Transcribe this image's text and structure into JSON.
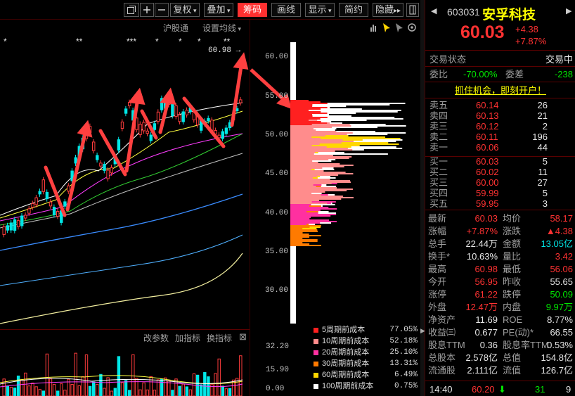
{
  "toolbar": {
    "buttons": [
      "复权",
      "叠加",
      "筹码",
      "画线",
      "显示",
      "简约",
      "隐藏"
    ],
    "active": "筹码",
    "icons": [
      "restore-icon",
      "plus-icon",
      "minus-icon",
      "collapse-icon"
    ]
  },
  "chart_header": {
    "hugutong": "沪股通",
    "ma_setting": "设置均线"
  },
  "kline": {
    "peak_label": "60.98",
    "star_markers": [
      "*",
      "**",
      "***",
      "*",
      "*",
      "*",
      "**"
    ],
    "price_ticks": [
      "60.00",
      "55.00",
      "50.00",
      "45.00",
      "40.00",
      "35.00",
      "30.00"
    ]
  },
  "volume": {
    "buttons": [
      "改参数",
      "加指标",
      "换指标"
    ],
    "close_glyph": "⊠",
    "ticks": [
      "32.20",
      "15.90",
      "0.00"
    ]
  },
  "chip_legend": [
    {
      "label": "5周期前成本",
      "value": "77.05%",
      "color": "#ff2020"
    },
    {
      "label": "10周期前成本",
      "value": "52.18%",
      "color": "#ff8c8c"
    },
    {
      "label": "20周期前成本",
      "value": "25.10%",
      "color": "#ff30a0"
    },
    {
      "label": "30周期前成本",
      "value": "13.31%",
      "color": "#ff7a00"
    },
    {
      "label": "60周期前成本",
      "value": "6.49%",
      "color": "#ffd700"
    },
    {
      "label": "100周期前成本",
      "value": "0.75%",
      "color": "#ffffff"
    }
  ],
  "stock": {
    "code": "603031",
    "name": "安孚科技",
    "price": "60.03",
    "change": "+4.38",
    "change_pct": "+7.87%"
  },
  "status": {
    "label": "交易状态",
    "value": "交易中",
    "weibi_label": "委比",
    "weibi": "-70.00%",
    "weicha_label": "委差",
    "weicha": "-238",
    "promo": "抓住机会，即刻开户！"
  },
  "asks": [
    {
      "label": "卖五",
      "price": "60.14",
      "vol": "26"
    },
    {
      "label": "卖四",
      "price": "60.13",
      "vol": "21"
    },
    {
      "label": "卖三",
      "price": "60.12",
      "vol": "2"
    },
    {
      "label": "卖二",
      "price": "60.11",
      "vol": "196"
    },
    {
      "label": "卖一",
      "price": "60.06",
      "vol": "44"
    }
  ],
  "bids": [
    {
      "label": "买一",
      "price": "60.03",
      "vol": "5"
    },
    {
      "label": "买二",
      "price": "60.02",
      "vol": "11"
    },
    {
      "label": "买三",
      "price": "60.00",
      "vol": "27"
    },
    {
      "label": "买四",
      "price": "59.99",
      "vol": "5"
    },
    {
      "label": "买五",
      "price": "59.95",
      "vol": "3"
    }
  ],
  "stats": [
    {
      "l1": "最新",
      "v1": "60.03",
      "c1": "red",
      "l2": "均价",
      "v2": "58.17",
      "c2": "red"
    },
    {
      "l1": "涨幅",
      "v1": "+7.87%",
      "c1": "red",
      "l2": "涨跌",
      "v2": "▲4.38",
      "c2": "red"
    },
    {
      "l1": "总手",
      "v1": "22.44万",
      "c1": "white",
      "l2": "金额",
      "v2": "13.05亿",
      "c2": "cyan"
    },
    {
      "l1": "换手*",
      "v1": "10.63%",
      "c1": "white",
      "l2": "量比",
      "v2": "3.42",
      "c2": "red"
    },
    {
      "l1": "最高",
      "v1": "60.98",
      "c1": "red",
      "l2": "最低",
      "v2": "56.06",
      "c2": "red"
    },
    {
      "l1": "今开",
      "v1": "56.95",
      "c1": "red",
      "l2": "昨收",
      "v2": "55.65",
      "c2": "white"
    },
    {
      "l1": "涨停",
      "v1": "61.22",
      "c1": "red",
      "l2": "跌停",
      "v2": "50.09",
      "c2": "green"
    },
    {
      "l1": "外盘",
      "v1": "12.47万",
      "c1": "red",
      "l2": "内盘",
      "v2": "9.97万",
      "c2": "green"
    },
    {
      "l1": "净资产",
      "v1": "11.69",
      "c1": "white",
      "l2": "ROE",
      "v2": "8.77%",
      "c2": "white"
    },
    {
      "l1": "收益㈢",
      "v1": "0.677",
      "c1": "white",
      "l2": "PE(动)*",
      "v2": "66.55",
      "c2": "white"
    },
    {
      "l1": "股息TTM",
      "v1": "0.36",
      "c1": "white",
      "l2": "股息率TTM",
      "v2": "0.53%",
      "c2": "white"
    },
    {
      "l1": "总股本",
      "v1": "2.578亿",
      "c1": "white",
      "l2": "总值",
      "v2": "154.8亿",
      "c2": "white"
    },
    {
      "l1": "流通股",
      "v1": "2.111亿",
      "c1": "white",
      "l2": "流值",
      "v2": "126.7亿",
      "c2": "white"
    }
  ],
  "tick": {
    "time": "14:40",
    "price": "60.20",
    "arrow": "⬇",
    "vol": "31",
    "count": "9"
  }
}
